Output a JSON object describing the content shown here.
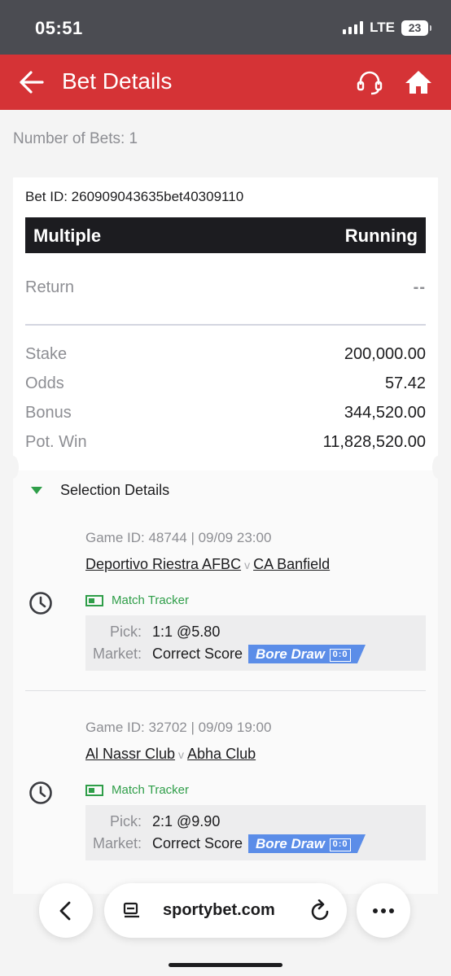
{
  "status_bar": {
    "time": "05:51",
    "network": "LTE",
    "battery": "23"
  },
  "header": {
    "title": "Bet Details"
  },
  "summary": {
    "number_of_bets": "Number of Bets: 1"
  },
  "bet": {
    "id_label": "Bet ID: 260909043635bet40309110",
    "type": "Multiple",
    "status": "Running",
    "return_label": "Return",
    "return_value": "--",
    "stake_label": "Stake",
    "stake_value": "200,000.00",
    "odds_label": "Odds",
    "odds_value": "57.42",
    "bonus_label": "Bonus",
    "bonus_value": "344,520.00",
    "potwin_label": "Pot. Win",
    "potwin_value": "11,828,520.00"
  },
  "selection": {
    "title": "Selection Details",
    "vs": "v",
    "tracker_label": "Match Tracker",
    "pick_label": "Pick:",
    "market_label": "Market:",
    "games": [
      {
        "meta": "Game ID: 48744 | 09/09 23:00",
        "home": "Deportivo Riestra AFBC",
        "away": "CA Banfield",
        "pick": "1:1 @5.80",
        "market": "Correct Score",
        "badge": "Bore Draw",
        "badge_score": "0:0"
      },
      {
        "meta": "Game ID: 32702 | 09/09 19:00",
        "home": "Al Nassr Club",
        "away": "Abha Club",
        "pick": "2:1 @9.90",
        "market": "Correct Score",
        "badge": "Bore Draw",
        "badge_score": "0:0"
      }
    ]
  },
  "browser": {
    "url": "sportybet.com"
  },
  "colors": {
    "header": "#d53336",
    "accent_green": "#2f9e49",
    "badge_blue": "#5b8de8",
    "type_bar": "#1c1c20"
  }
}
